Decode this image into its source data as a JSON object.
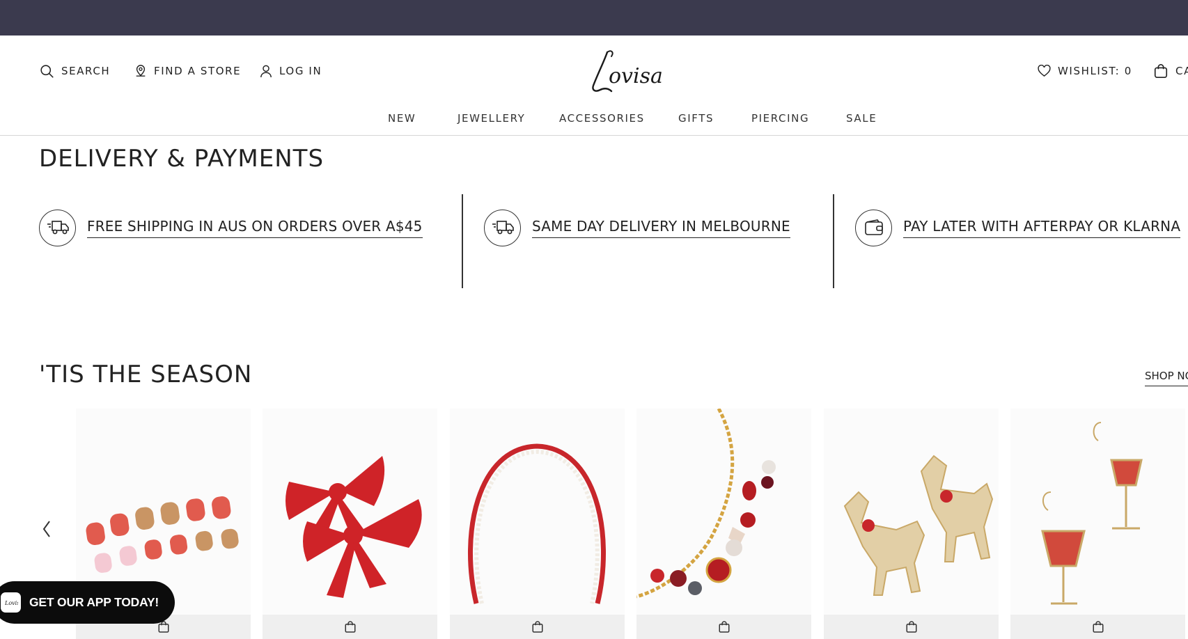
{
  "header": {
    "search_label": "SEARCH",
    "find_store_label": "FIND A STORE",
    "login_label": "LOG IN",
    "wishlist_label": "WISHLIST: 0",
    "cart_label": "CA",
    "logo_text": "Lovisa"
  },
  "nav": {
    "new": "NEW",
    "jewellery": "JEWELLERY",
    "accessories": "ACCESSORIES",
    "gifts": "GIFTS",
    "piercing": "PIERCING",
    "sale": "SALE"
  },
  "delivery": {
    "title": "DELIVERY & PAYMENTS",
    "items": [
      {
        "text": "FREE SHIPPING IN AUS ON ORDERS OVER A$45",
        "icon": "delivery-truck-icon"
      },
      {
        "text": "SAME DAY DELIVERY IN MELBOURNE",
        "icon": "delivery-truck-icon"
      },
      {
        "text": "PAY LATER WITH AFTERPAY OR KLARNA",
        "icon": "wallet-icon"
      }
    ]
  },
  "season": {
    "title": "'TIS THE SEASON",
    "shop_now": "SHOP NO"
  },
  "products": [
    {
      "kind": "press-on-nails"
    },
    {
      "kind": "red-hair-bows"
    },
    {
      "kind": "pearl-headband"
    },
    {
      "kind": "christmas-charm-necklace"
    },
    {
      "kind": "reindeer-earrings"
    },
    {
      "kind": "wine-glass-earrings"
    }
  ],
  "app_banner": {
    "text": "GET OUR APP TODAY!"
  },
  "colors": {
    "topbar": "#3b3a4e",
    "text": "#222222",
    "product_red": "#c8262b"
  }
}
